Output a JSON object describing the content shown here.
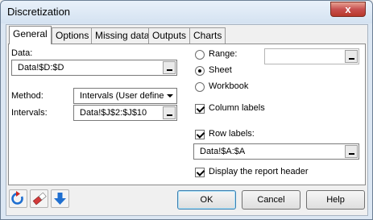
{
  "window": {
    "title": "Discretization",
    "close_glyph": "x"
  },
  "tabs": [
    {
      "label": "General",
      "active": true
    },
    {
      "label": "Options",
      "active": false
    },
    {
      "label": "Missing data",
      "active": false
    },
    {
      "label": "Outputs",
      "active": false
    },
    {
      "label": "Charts",
      "active": false
    }
  ],
  "general": {
    "data_label": "Data:",
    "data_value": "Data!$D:$D",
    "method_label": "Method:",
    "method_value": "Intervals (User defined)",
    "intervals_label": "Intervals:",
    "intervals_value": "Data!$J$2:$J$10",
    "range_label": "Range:",
    "range_value": "",
    "sheet_label": "Sheet",
    "workbook_label": "Workbook",
    "output_selected": "Sheet",
    "column_labels_label": "Column labels",
    "column_labels_checked": true,
    "row_labels_label": "Row labels:",
    "row_labels_checked": true,
    "row_labels_value": "Data!$A:$A",
    "display_header_label": "Display the report header",
    "display_header_checked": true
  },
  "footer": {
    "icons": [
      "reset-icon",
      "eraser-icon",
      "download-arrow-icon"
    ],
    "ok_label": "OK",
    "cancel_label": "Cancel",
    "help_label": "Help"
  },
  "colors": {
    "frame": "#dce7f3",
    "close_button": "#c75050",
    "accent_blue": "#1f6fd0"
  }
}
